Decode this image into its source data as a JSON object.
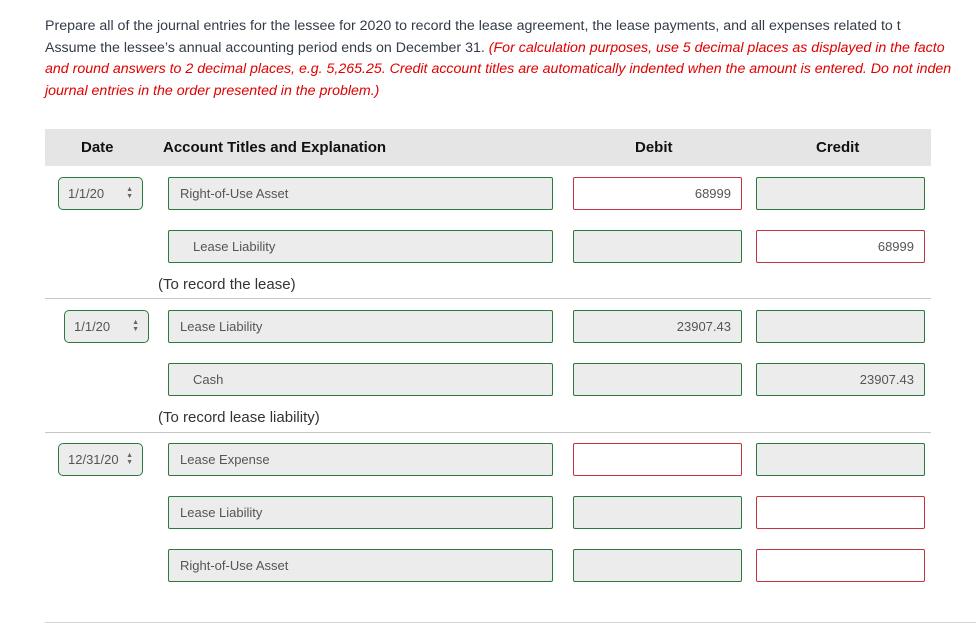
{
  "instructions": {
    "line1": "Prepare all of the journal entries for the lessee for 2020 to record the lease agreement, the lease payments, and all expenses related to t",
    "line2_plain": "Assume the lessee’s annual accounting period ends on December 31. ",
    "line2_red": "(For calculation purposes, use 5 decimal places as displayed in the facto",
    "line3_red": "and round answers to 2 decimal places, e.g. 5,265.25. Credit account titles are automatically indented when the amount is entered. Do not inden",
    "line4_red": "journal entries in the order presented in the problem.)"
  },
  "colors": {
    "correct_border": "#2b7a3c",
    "incorrect_border": "#c0343d",
    "instruction_red": "#e00000"
  },
  "table": {
    "headers": {
      "date": "Date",
      "account": "Account Titles and Explanation",
      "debit": "Debit",
      "credit": "Credit"
    },
    "entries": [
      {
        "date": "1/1/20",
        "date_status": "correct",
        "explanation": "(To record the lease)",
        "lines": [
          {
            "account": "Right-of-Use Asset",
            "account_status": "correct",
            "debit": "68999",
            "debit_status": "incorrect",
            "credit": "",
            "credit_status": "correct"
          },
          {
            "account": "Lease Liability",
            "account_status": "correct",
            "debit": "",
            "debit_status": "correct",
            "credit": "68999",
            "credit_status": "incorrect"
          }
        ]
      },
      {
        "date": "1/1/20",
        "date_status": "correct",
        "explanation": "(To record lease liability)",
        "lines": [
          {
            "account": "Lease Liability",
            "account_status": "correct",
            "debit": "23907.43",
            "debit_status": "correct",
            "credit": "",
            "credit_status": "correct"
          },
          {
            "account": "Cash",
            "account_status": "correct",
            "debit": "",
            "debit_status": "correct",
            "credit": "23907.43",
            "credit_status": "correct"
          }
        ]
      },
      {
        "date": "12/31/20",
        "date_status": "correct",
        "explanation": "",
        "lines": [
          {
            "account": "Lease Expense",
            "account_status": "correct",
            "debit": "",
            "debit_status": "incorrect",
            "credit": "",
            "credit_status": "correct"
          },
          {
            "account": "Lease Liability",
            "account_status": "correct",
            "debit": "",
            "debit_status": "correct",
            "credit": "",
            "credit_status": "incorrect"
          },
          {
            "account": "Right-of-Use Asset",
            "account_status": "correct",
            "debit": "",
            "debit_status": "correct",
            "credit": "",
            "credit_status": "incorrect"
          }
        ]
      }
    ]
  }
}
